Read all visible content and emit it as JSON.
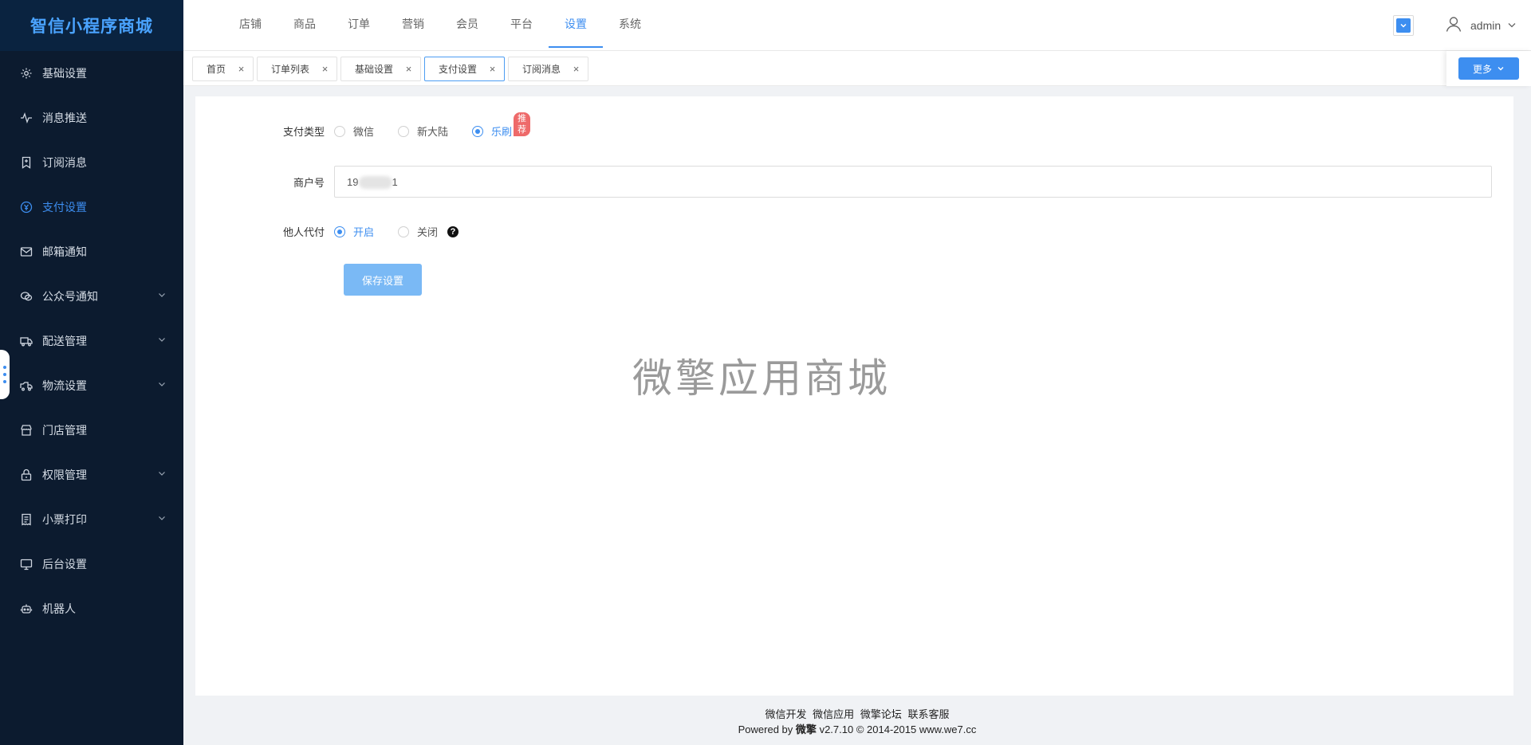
{
  "app": {
    "title": "智信小程序商城"
  },
  "sidebar": {
    "items": [
      {
        "label": "基础设置",
        "icon": "gear-icon"
      },
      {
        "label": "消息推送",
        "icon": "pulse-icon"
      },
      {
        "label": "订阅消息",
        "icon": "bookmark-icon"
      },
      {
        "label": "支付设置",
        "icon": "payment-icon"
      },
      {
        "label": "邮箱通知",
        "icon": "mail-icon"
      },
      {
        "label": "公众号通知",
        "icon": "wechat-icon"
      },
      {
        "label": "配送管理",
        "icon": "delivery-truck-icon"
      },
      {
        "label": "物流设置",
        "icon": "logistics-truck-icon"
      },
      {
        "label": "门店管理",
        "icon": "store-icon"
      },
      {
        "label": "权限管理",
        "icon": "lock-icon"
      },
      {
        "label": "小票打印",
        "icon": "receipt-icon"
      },
      {
        "label": "后台设置",
        "icon": "monitor-icon"
      },
      {
        "label": "机器人",
        "icon": "robot-icon"
      }
    ],
    "active_index": 3
  },
  "topnav": {
    "items": [
      "店铺",
      "商品",
      "订单",
      "营销",
      "会员",
      "平台",
      "设置",
      "系统"
    ],
    "active_index": 6
  },
  "header": {
    "username": "admin"
  },
  "tabs": {
    "items": [
      "首页",
      "订单列表",
      "基础设置",
      "支付设置",
      "订阅消息"
    ],
    "active_index": 3,
    "more_label": "更多"
  },
  "form": {
    "pay_type": {
      "label": "支付类型",
      "options": [
        "微信",
        "新大陆",
        "乐刷"
      ],
      "selected": "乐刷",
      "badge": "推荐"
    },
    "merchant_no": {
      "label": "商户号",
      "value_start": "19",
      "value_end": "1"
    },
    "proxy_pay": {
      "label": "他人代付",
      "options": [
        "开启",
        "关闭"
      ],
      "selected": "开启"
    },
    "save_label": "保存设置"
  },
  "watermark": "微擎应用商城",
  "footer": {
    "links": [
      "微信开发",
      "微信应用",
      "微擎论坛",
      "联系客服"
    ],
    "powered_prefix": "Powered by",
    "brand": "微擎",
    "version": "v2.7.10",
    "copyright": "© 2014-2015",
    "site": "www.we7.cc"
  },
  "colors": {
    "accent": "#3d8ef0",
    "sidebar_bg": "#0c1b2f",
    "badge": "#ee6a6a"
  }
}
